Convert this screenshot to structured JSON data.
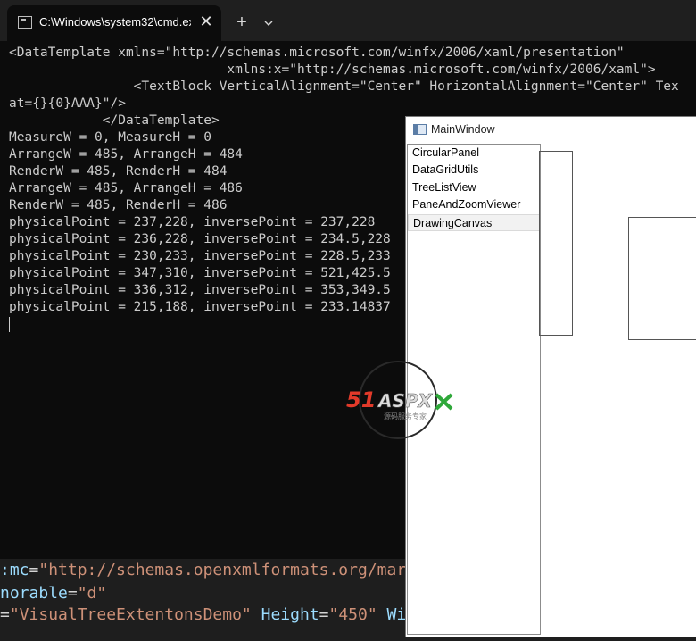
{
  "editor": {
    "line1": {
      "attr": ":mc",
      "eq": "=",
      "value": "\"http://schemas.openxmlformats.org/mar"
    },
    "line2": {
      "attr": "norable",
      "eq": "=",
      "value": "\"d\""
    },
    "line3": {
      "eq": "=",
      "value1": "\"VisualTreeExtentonsDemo\"",
      "attr2": " Height",
      "eq2": "=",
      "value2": "\"450\"",
      "attr3": " Wi"
    }
  },
  "terminal": {
    "tab_title": "C:\\Windows\\system32\\cmd.exe",
    "close_glyph": "✕",
    "new_tab_glyph": "+",
    "lines": [
      "<DataTemplate xmlns=\"http://schemas.microsoft.com/winfx/2006/xaml/presentation\"",
      "                            xmlns:x=\"http://schemas.microsoft.com/winfx/2006/xaml\">",
      "                <TextBlock VerticalAlignment=\"Center\" HorizontalAlignment=\"Center\" Tex",
      "at={}{0}AAA}\"/>",
      "            </DataTemplate>",
      "MeasureW = 0, MeasureH = 0",
      "ArrangeW = 485, ArrangeH = 484",
      "RenderW = 485, RenderH = 484",
      "ArrangeW = 485, ArrangeH = 486",
      "RenderW = 485, RenderH = 486",
      "physicalPoint = 237,228, inversePoint = 237,228",
      "physicalPoint = 236,228, inversePoint = 234.5,228",
      "physicalPoint = 230,233, inversePoint = 228.5,233",
      "physicalPoint = 347,310, inversePoint = 521,425.5",
      "physicalPoint = 336,312, inversePoint = 353,349.5",
      "physicalPoint = 215,188, inversePoint = 233.14837"
    ]
  },
  "main_window": {
    "title": "MainWindow",
    "items": [
      "CircularPanel",
      "DataGridUtils",
      "TreeListView",
      "PaneAndZoomViewer",
      "DrawingCanvas"
    ],
    "selected_item": "DrawingCanvas"
  },
  "watermark": {
    "brand_number": "51",
    "brand_text": "ASPX",
    "tagline": "源码服务专家"
  },
  "colors": {
    "terminal_bg": "#0c0c0c",
    "terminal_text": "#cccccc",
    "logo_red": "#e23a2a",
    "logo_green": "#2fa83a"
  }
}
